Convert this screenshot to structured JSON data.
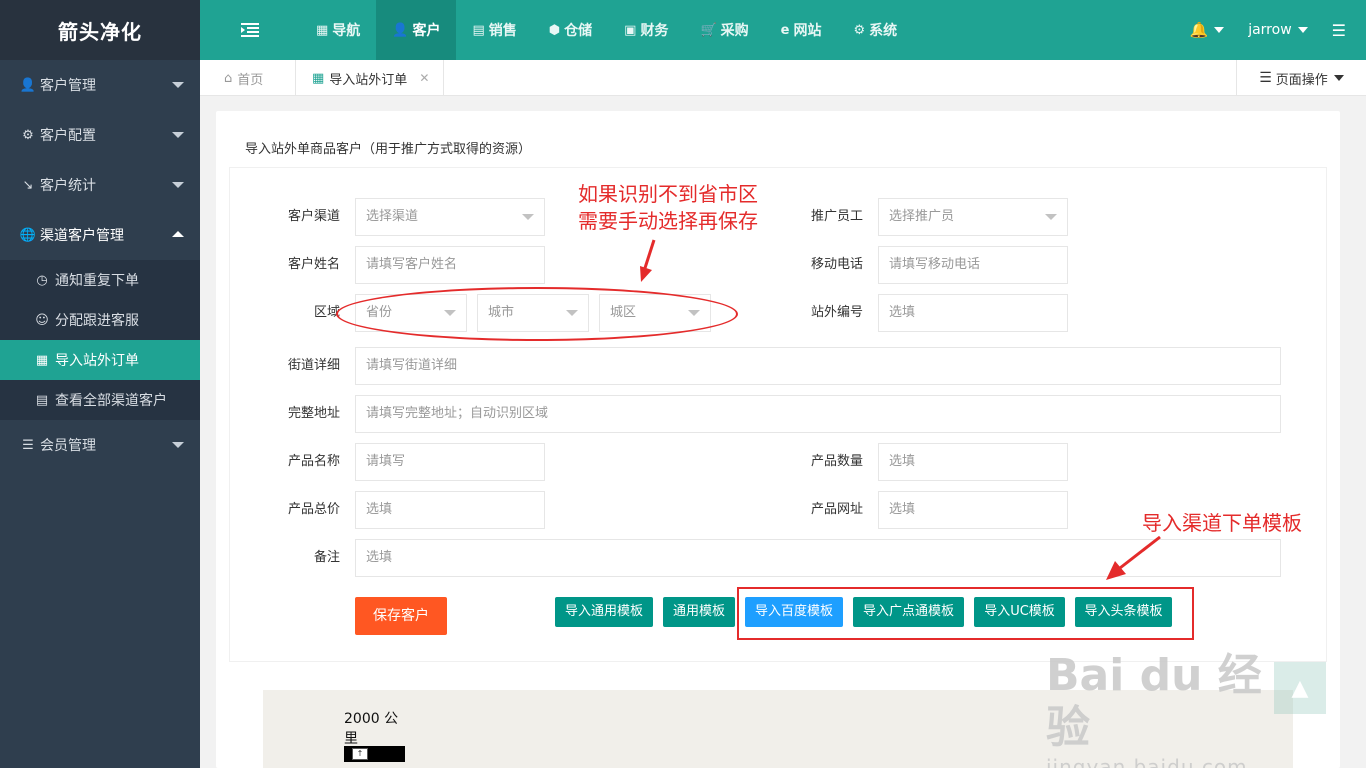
{
  "brand": "箭头净化",
  "sidebar": {
    "items": [
      {
        "label": "客户管理",
        "icon": "user-icon"
      },
      {
        "label": "客户配置",
        "icon": "gear-icon"
      },
      {
        "label": "客户统计",
        "icon": "line-chart-icon"
      },
      {
        "label": "渠道客户管理",
        "icon": "globe-icon"
      },
      {
        "label": "会员管理",
        "icon": "list-icon"
      }
    ],
    "submenu": [
      {
        "label": "通知重复下单",
        "icon": "clock-icon"
      },
      {
        "label": "分配跟进客服",
        "icon": "user-list-icon"
      },
      {
        "label": "导入站外订单",
        "icon": "sitemap-icon"
      },
      {
        "label": "查看全部渠道客户",
        "icon": "clipboard-icon"
      }
    ]
  },
  "topnav": {
    "items": [
      {
        "label": "导航",
        "icon": "grid-icon"
      },
      {
        "label": "客户",
        "icon": "user-icon"
      },
      {
        "label": "销售",
        "icon": "file-icon"
      },
      {
        "label": "仓储",
        "icon": "box-icon"
      },
      {
        "label": "财务",
        "icon": "money-icon"
      },
      {
        "label": "采购",
        "icon": "cart-icon"
      },
      {
        "label": "网站",
        "icon": "ie-icon"
      },
      {
        "label": "系统",
        "icon": "gear-icon"
      }
    ],
    "username": "jarrow"
  },
  "tabs": {
    "home": "首页",
    "current": "导入站外订单",
    "page_ops": "页面操作"
  },
  "form": {
    "title": "导入站外单商品客户（用于推广方式取得的资源）",
    "channel_label": "客户渠道",
    "channel_placeholder": "选择渠道",
    "promoter_label": "推广员工",
    "promoter_placeholder": "选择推广员",
    "name_label": "客户姓名",
    "name_placeholder": "请填写客户姓名",
    "mobile_label": "移动电话",
    "mobile_placeholder": "请填写移动电话",
    "region_label": "区域",
    "province_placeholder": "省份",
    "city_placeholder": "城市",
    "district_placeholder": "城区",
    "external_no_label": "站外编号",
    "external_no_placeholder": "选填",
    "street_label": "街道详细",
    "street_placeholder": "请填写街道详细",
    "full_address_label": "完整地址",
    "full_address_placeholder": "请填写完整地址；自动识别区域",
    "product_name_label": "产品名称",
    "product_name_placeholder": "请填写",
    "product_qty_label": "产品数量",
    "product_qty_placeholder": "选填",
    "product_total_label": "产品总价",
    "product_total_placeholder": "选填",
    "product_url_label": "产品网址",
    "product_url_placeholder": "选填",
    "remark_label": "备注",
    "remark_placeholder": "选填"
  },
  "buttons": {
    "save": "保存客户",
    "import_general": "导入通用模板",
    "general_template": "通用模板",
    "import_baidu": "导入百度模板",
    "import_gdt": "导入广点通模板",
    "import_uc": "导入UC模板",
    "import_toutiao": "导入头条模板"
  },
  "annotations": {
    "region_note_line1": "如果识别不到省市区",
    "region_note_line2": "需要手动选择再保存",
    "template_note": "导入渠道下单模板"
  },
  "map": {
    "scale_text_line1": "2000 公",
    "scale_text_line2": "里"
  },
  "watermark": {
    "main": "Bai du 经验",
    "sub": "jingyan.baidu.com"
  },
  "colors": {
    "accent": "#1fa393",
    "sidebar": "#2f3e4e",
    "save_button": "#ff5722",
    "primary_button": "#009688",
    "highlight_button": "#1e9fff",
    "annotation": "#e42b2b"
  }
}
